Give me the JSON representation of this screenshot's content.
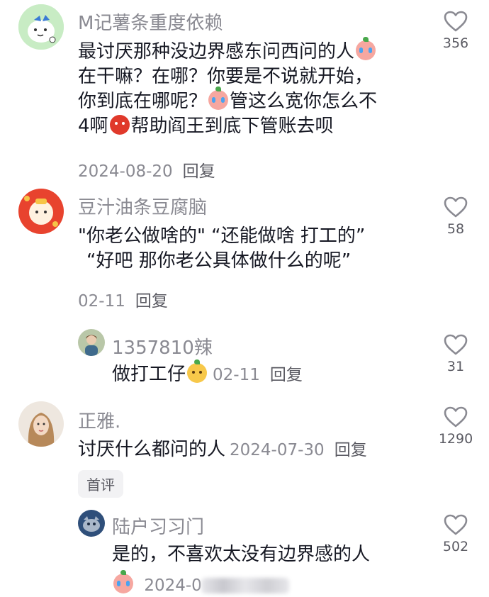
{
  "comments": [
    {
      "username": "M记薯条重度依赖",
      "lines": [
        "最讨厌那种没边界感东问西问的人",
        "在干嘛？在哪？你要是不说就开始，",
        "你到底在哪呢？",
        "管这么宽你怎么不",
        "4啊",
        "帮助阎王到底下管账去呗"
      ],
      "date": "2024-08-20",
      "reply": "回复",
      "likes": "356"
    },
    {
      "username": "豆汁油条豆腐脑",
      "lines": [
        "\"你老公做啥的\" “还能做啥 打工的”",
        "“好吧 那你老公具体做什么的呢”"
      ],
      "date": "02-11",
      "reply": "回复",
      "likes": "58"
    },
    {
      "username": "1357810辣",
      "lines": [
        "做打工仔"
      ],
      "date": "02-11",
      "reply": "回复",
      "likes": "31"
    },
    {
      "username": "正雅.",
      "lines": [
        "讨厌什么都问的人"
      ],
      "date": "2024-07-30",
      "reply": "回复",
      "badge": "首评",
      "likes": "1290"
    },
    {
      "username": "陆户习习门",
      "lines": [
        "是的，不喜欢太没有边界感的人"
      ],
      "date": "2024-0",
      "likes": "502"
    }
  ],
  "colors": {
    "username": "#8a8a92",
    "text": "#161823",
    "like_icon": "#8a8a92"
  },
  "icons": {
    "like": "heart-outline-icon",
    "emoji_cry": "crying-face-emoji",
    "emoji_devil": "angry-devil-emoji",
    "emoji_shy": "shy-face-emoji"
  }
}
